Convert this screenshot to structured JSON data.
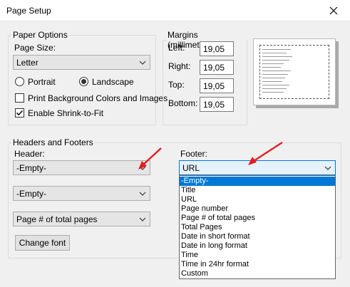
{
  "window": {
    "title": "Page Setup",
    "close_icon": "close-icon"
  },
  "paper_options": {
    "legend": "Paper Options",
    "page_size_label": "Page Size:",
    "page_size_value": "Letter",
    "portrait_label": "Portrait",
    "landscape_label": "Landscape",
    "orientation_selected": "Landscape",
    "print_background_label": "Print Background Colors and Images",
    "print_background_checked": false,
    "shrink_to_fit_label": "Enable Shrink-to-Fit",
    "shrink_to_fit_checked": true
  },
  "margins": {
    "legend": "Margins (millimeters)",
    "left_label": "Left:",
    "left_value": "19,05",
    "right_label": "Right:",
    "right_value": "19,05",
    "top_label": "Top:",
    "top_value": "19,05",
    "bottom_label": "Bottom:",
    "bottom_value": "19,05"
  },
  "headers_footers": {
    "legend": "Headers and Footers",
    "header_label": "Header:",
    "header_1": "-Empty-",
    "header_2": "-Empty-",
    "header_3": "Page # of total pages",
    "footer_label": "Footer:",
    "footer_1": "URL",
    "change_font_label": "Change font",
    "footer_options": [
      "-Empty-",
      "Title",
      "URL",
      "Page number",
      "Page # of total pages",
      "Total Pages",
      "Date in short format",
      "Date in long format",
      "Time",
      "Time in 24hr format",
      "Custom"
    ],
    "highlighted_option": "-Empty-"
  },
  "colors": {
    "selection": "#0078d7",
    "annotation_arrow": "#e41e1e"
  }
}
